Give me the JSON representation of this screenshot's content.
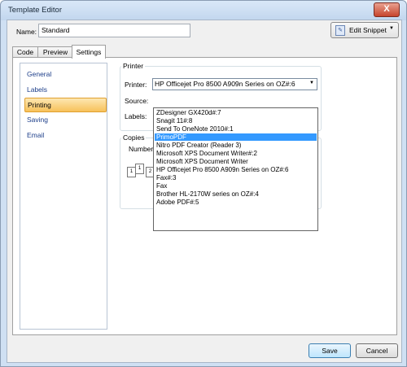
{
  "window": {
    "title": "Template Editor",
    "close_glyph": "X"
  },
  "name_field": {
    "label": "Name:",
    "value": "Standard"
  },
  "edit_snippet": {
    "label": "Edit Snippet",
    "icon": "snippet-icon",
    "arrow": "▼"
  },
  "tabs": [
    "Code",
    "Preview",
    "Settings"
  ],
  "active_tab": "Settings",
  "nav": [
    "General",
    "Labels",
    "Printing",
    "Saving",
    "Email"
  ],
  "active_nav": "Printing",
  "printer_group": {
    "title": "Printer",
    "printer_label": "Printer:",
    "printer_value": "HP Officejet Pro 8500 A909n Series on OZ#:6",
    "source_label": "Source:",
    "labels_label": "Labels:"
  },
  "copies_group": {
    "title": "Copies",
    "number_label": "Number"
  },
  "printer_options": [
    "ZDesigner GX420d#:7",
    "Snagit 11#:8",
    "Send To OneNote 2010#:1",
    "PrimoPDF",
    "Nitro PDF Creator (Reader 3)",
    "Microsoft XPS Document Writer#:2",
    "Microsoft XPS Document Writer",
    "HP Officejet Pro 8500 A909n Series on OZ#:6",
    "Fax#:3",
    "Fax",
    "Brother HL-2170W series on OZ#:4",
    "Adobe PDF#:5"
  ],
  "highlighted_option": "PrimoPDF",
  "buttons": {
    "save": "Save",
    "cancel": "Cancel"
  },
  "colors": {
    "selection": "#3399ff",
    "nav_active": "#f7c15a",
    "link": "#1e3f8a"
  }
}
